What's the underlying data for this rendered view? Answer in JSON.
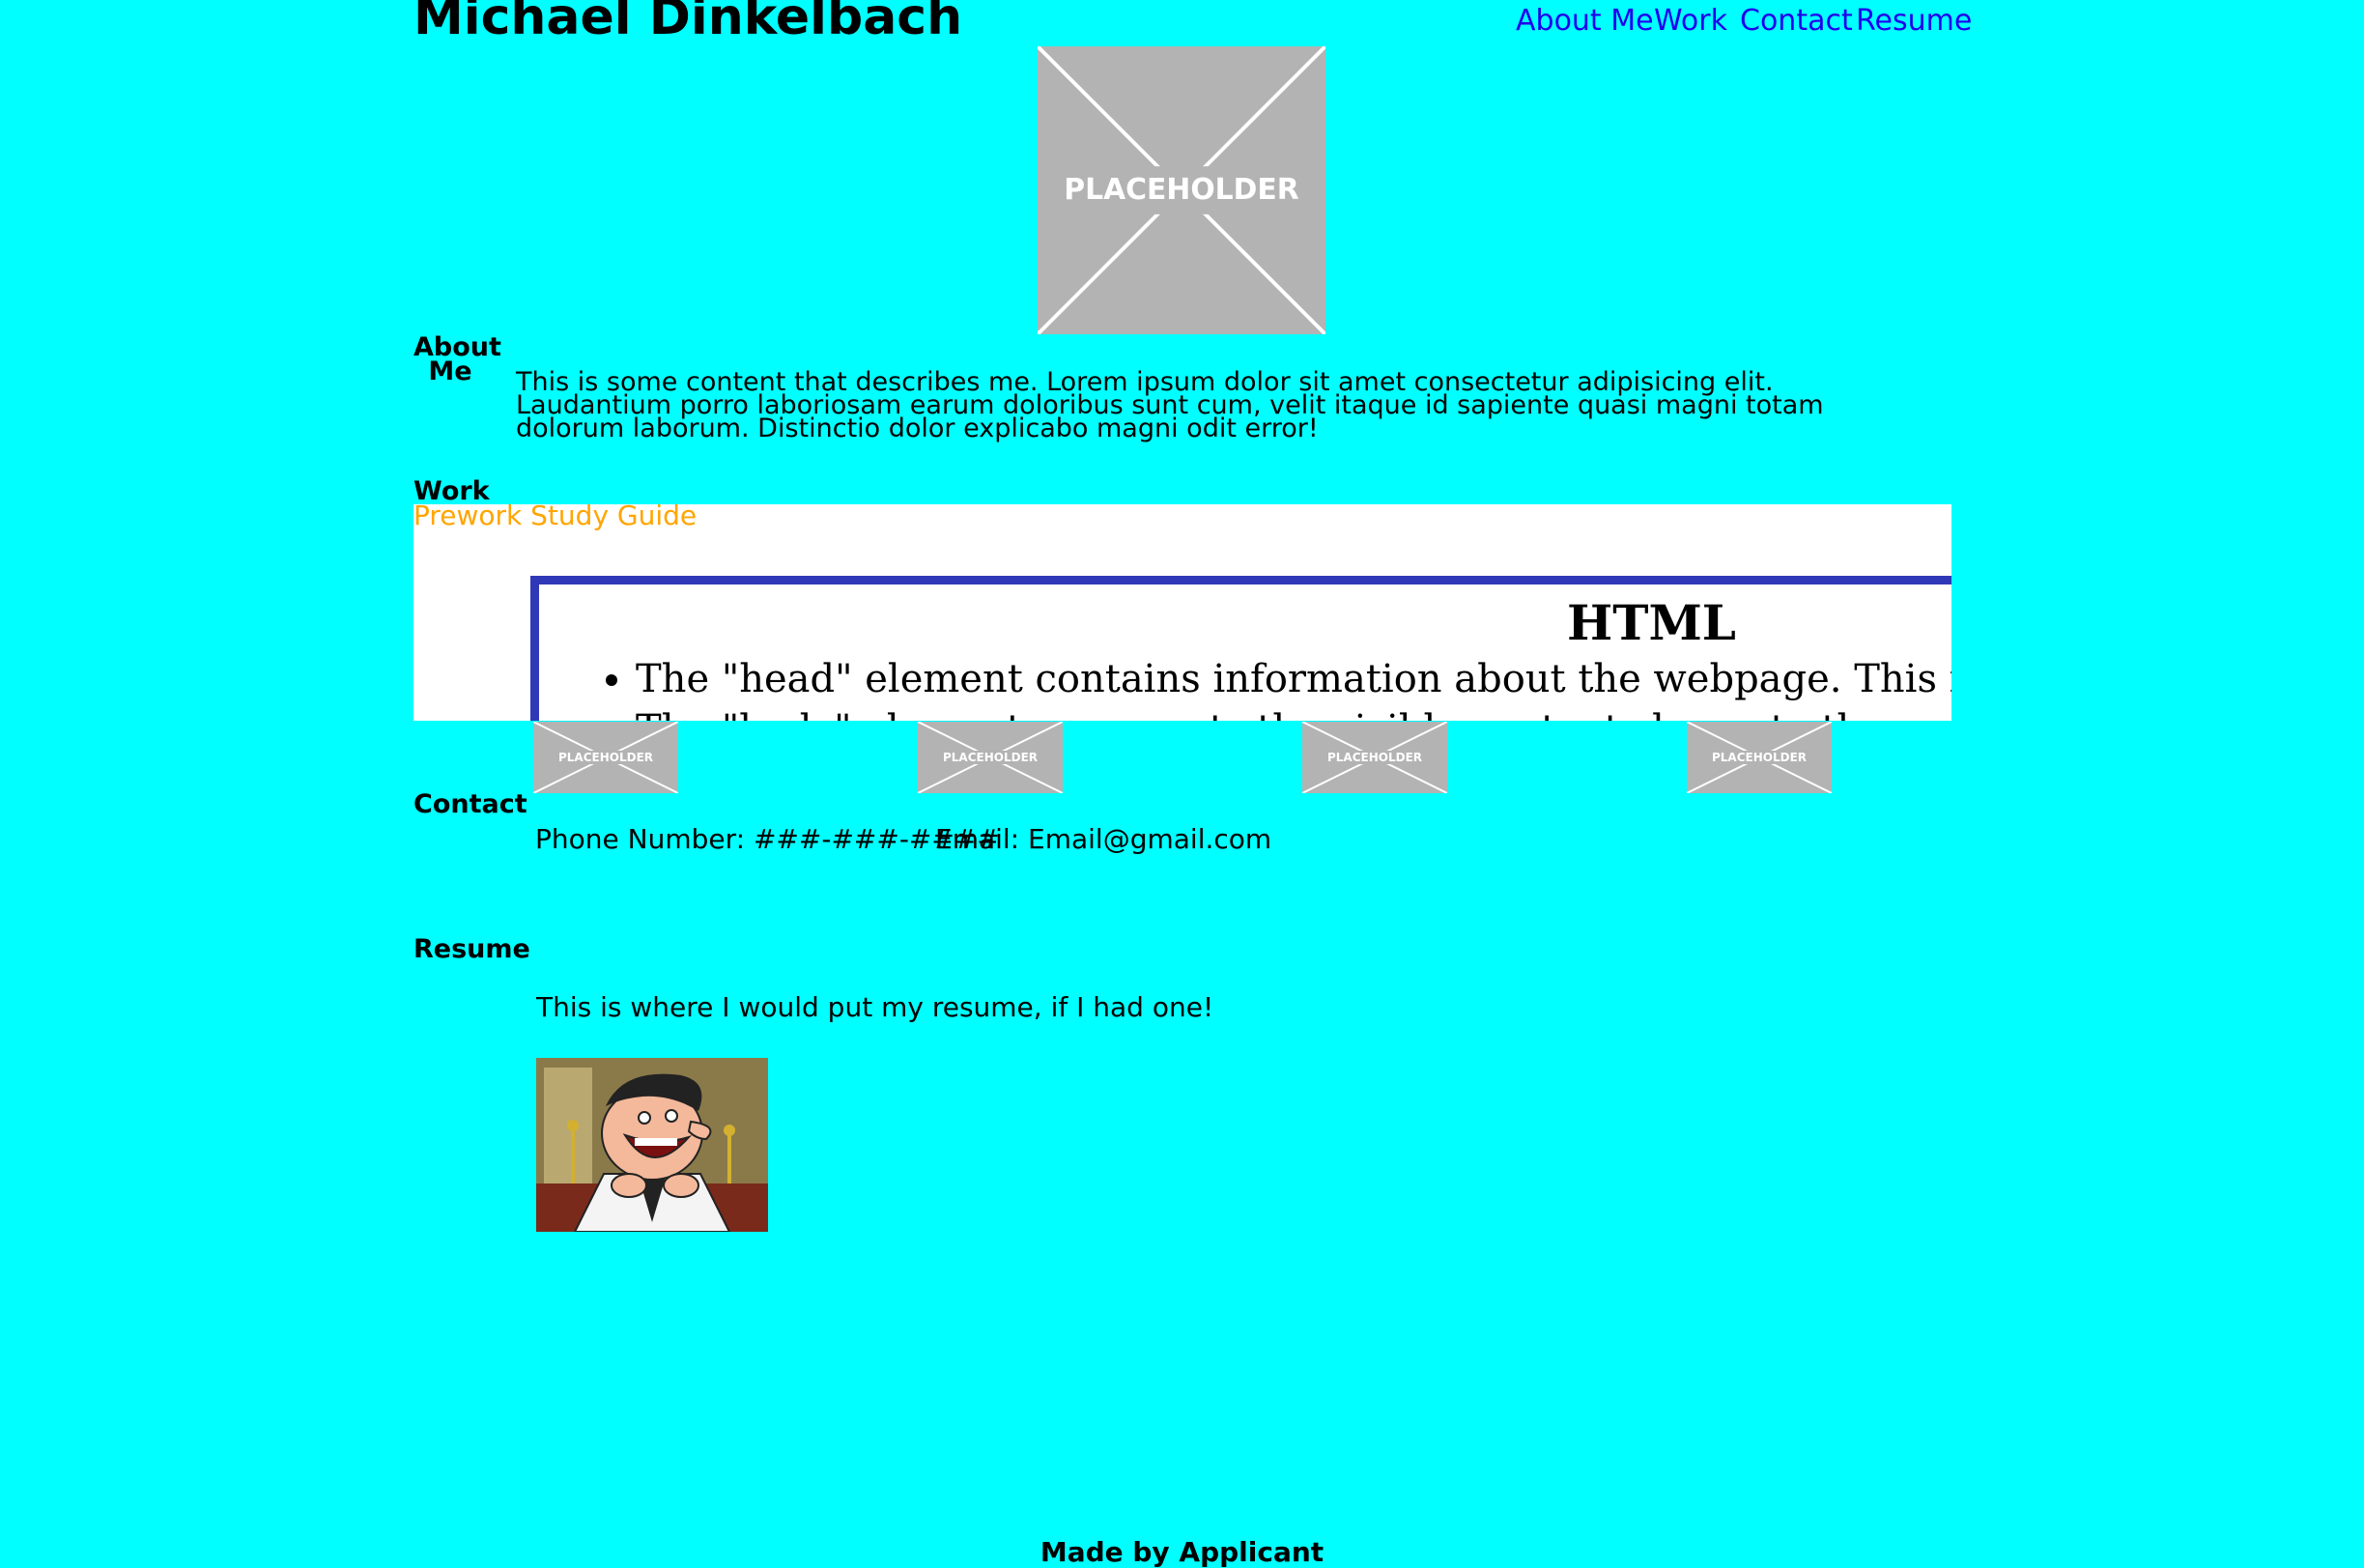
{
  "header": {
    "title": "Michael Dinkelbach",
    "nav": [
      "About Me",
      "Work",
      "Contact",
      "Resume"
    ]
  },
  "colors": {
    "background": "#00ffff",
    "nav_link": "#2200ee",
    "work_link": "#ffa500",
    "placeholder": "#b3b3b3"
  },
  "hero_image": {
    "text": "PLACEHOLDER",
    "icon": "placeholder-image"
  },
  "about": {
    "heading_line1": "About",
    "heading_line2": "Me",
    "text": "This is some content that describes me. Lorem ipsum dolor sit amet consectetur adipisicing elit. Laudantium porro laboriosam earum doloribus sunt cum, velit itaque id sapiente quasi magni totam dolorum laborum. Distinctio dolor explicabo magni odit error!"
  },
  "work": {
    "heading": "Work",
    "link_text": "Prework Study Guide",
    "preview": {
      "heading": "HTML",
      "items": [
        "The \"head\" element contains information about the webpage. This information is not shown to the user.",
        "The \"body\" element represents the visible content shown to the user."
      ]
    },
    "thumbnails": [
      "PLACEHOLDER",
      "PLACEHOLDER",
      "PLACEHOLDER",
      "PLACEHOLDER"
    ]
  },
  "contact": {
    "heading": "Contact",
    "phone": "Phone Number: ###-###-####",
    "email": "Email: Email@gmail.com"
  },
  "resume": {
    "heading": "Resume",
    "text": "This is where I would put my resume, if I had one!",
    "image_icon": "cartoon-character-meme"
  },
  "footer": {
    "text": "Made by Applicant"
  }
}
